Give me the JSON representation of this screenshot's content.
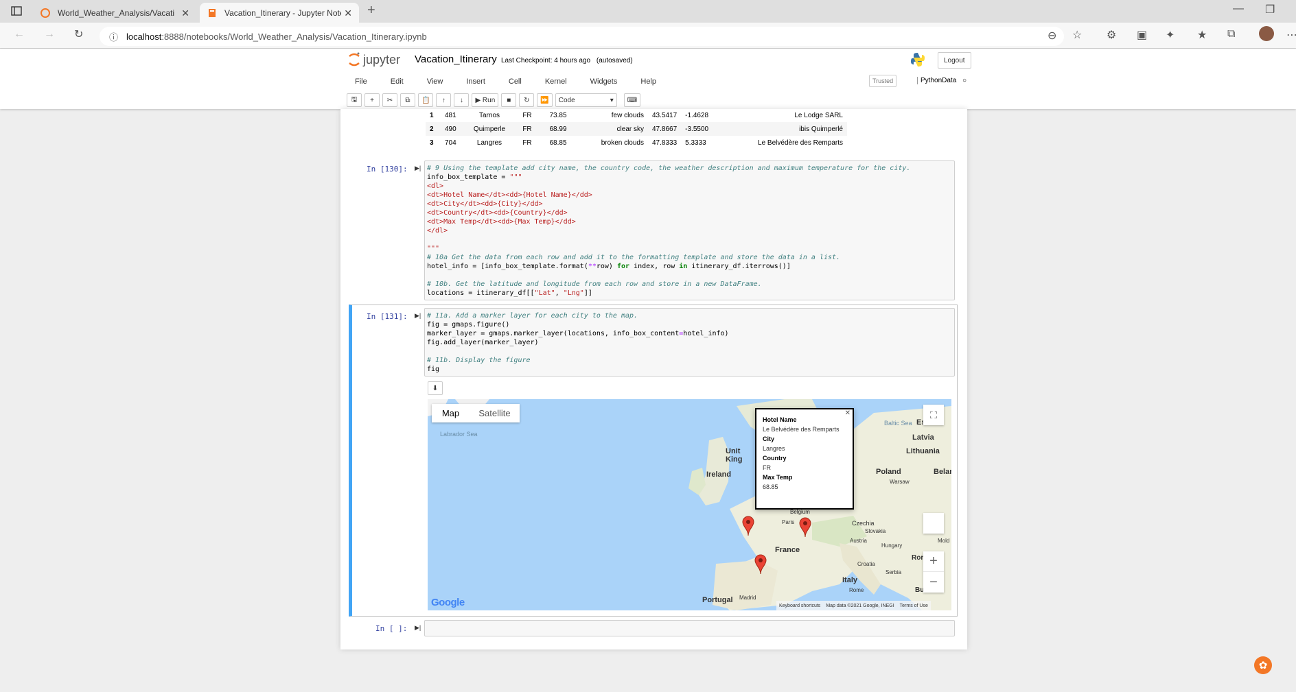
{
  "browser": {
    "tabs": [
      {
        "title": "World_Weather_Analysis/Vacation_Itinerary",
        "active": false
      },
      {
        "title": "Vacation_Itinerary - Jupyter Notebook",
        "active": true
      }
    ],
    "url_host": "localhost",
    "url_rest": ":8888/notebooks/World_Weather_Analysis/Vacation_Itinerary.ipynb"
  },
  "jupyter": {
    "logo_text": "jupyter",
    "notebook_name": "Vacation_Itinerary",
    "checkpoint": "Last Checkpoint: 4 hours ago",
    "autosaved": "(autosaved)",
    "logout": "Logout",
    "menu": [
      "File",
      "Edit",
      "View",
      "Insert",
      "Cell",
      "Kernel",
      "Widgets",
      "Help"
    ],
    "trusted": "Trusted",
    "kernel_name": "PythonData",
    "toolbar": {
      "run": "Run",
      "cell_type": "Code"
    }
  },
  "df_rows": [
    [
      "1",
      "481",
      "Tarnos",
      "FR",
      "73.85",
      "few clouds",
      "43.5417",
      "-1.4628",
      "Le Lodge SARL"
    ],
    [
      "2",
      "490",
      "Quimperle",
      "FR",
      "68.99",
      "clear sky",
      "47.8667",
      "-3.5500",
      "ibis Quimperlé"
    ],
    [
      "3",
      "704",
      "Langres",
      "FR",
      "68.85",
      "broken clouds",
      "47.8333",
      "5.3333",
      "Le Belvédère des Remparts"
    ]
  ],
  "cells": [
    {
      "prompt": "In [130]:"
    },
    {
      "prompt": "In [131]:"
    },
    {
      "prompt": "In [ ]:"
    }
  ],
  "map": {
    "tabs": [
      "Map",
      "Satellite"
    ],
    "infobox": {
      "hotel_label": "Hotel Name",
      "hotel": "Le Belvédère des Remparts",
      "city_label": "City",
      "city": "Langres",
      "country_label": "Country",
      "country": "FR",
      "temp_label": "Max Temp",
      "temp": "68.85"
    },
    "labels": {
      "labrador": "Labrador Sea",
      "baltic": "Baltic Sea",
      "estonia": "Estonia",
      "latvia": "Latvia",
      "lithuania": "Lithuania",
      "ireland": "Ireland",
      "uk": "Unit King",
      "poland": "Poland",
      "warsaw": "Warsaw",
      "belarus": "Belar",
      "belgium": "Belgium",
      "paris": "Paris",
      "czechia": "Czechia",
      "slovakia": "Slovakia",
      "moldova": "Mold",
      "austria": "Austria",
      "hungary": "Hungary",
      "france": "France",
      "croatia": "Croatia",
      "serbia": "Serbia",
      "romania": "Ror",
      "italy": "Italy",
      "rome": "Rome",
      "bulgaria": "Bu",
      "portugal": "Portugal",
      "madrid": "Madrid"
    },
    "footer": {
      "keyboard": "Keyboard shortcuts",
      "data": "Map data ©2021 Google, INEGI",
      "terms": "Terms of Use"
    },
    "google": "Google",
    "zoom_in": "+",
    "zoom_out": "−",
    "pin_color": "#ea4335",
    "water_color": "#aad3f9"
  }
}
